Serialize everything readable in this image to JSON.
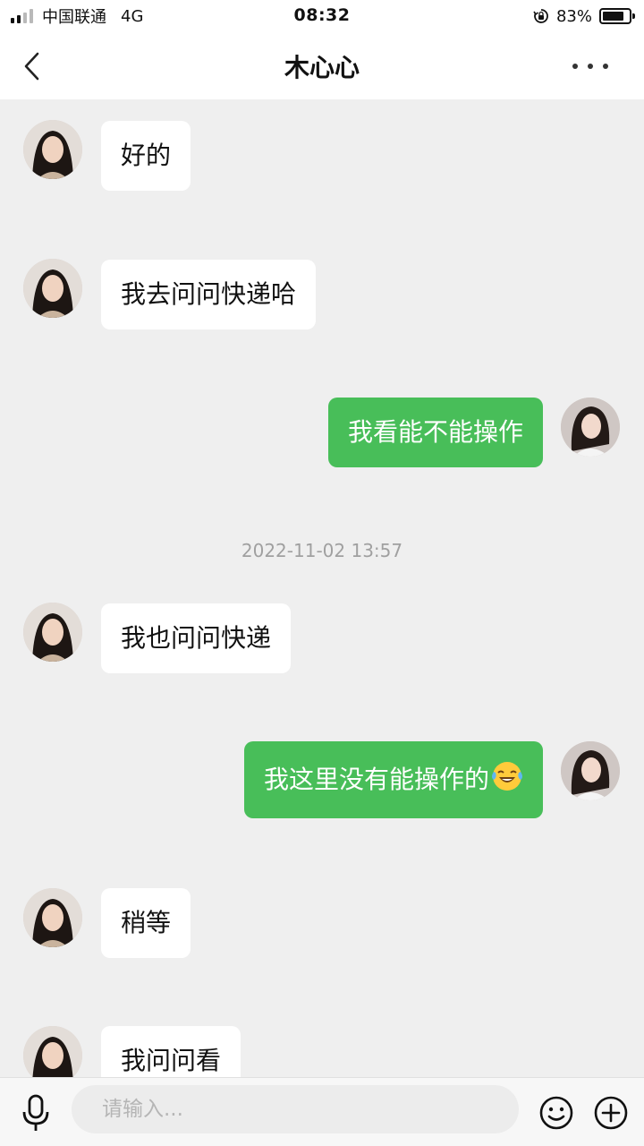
{
  "status_bar": {
    "carrier": "中国联通",
    "network": "4G",
    "time": "08:32",
    "battery_percent": "83%",
    "battery_level": 0.83
  },
  "nav": {
    "title": "木心心",
    "back_icon": "chevron-left-icon",
    "more_icon": "more-dots-icon"
  },
  "messages": [
    {
      "direction": "in",
      "text": "好的"
    },
    {
      "direction": "in",
      "text": "我去问问快递哈"
    },
    {
      "direction": "out",
      "text": "我看能不能操作"
    },
    {
      "type": "timestamp",
      "text": "2022-11-02 13:57"
    },
    {
      "direction": "in",
      "text": "我也问问快递"
    },
    {
      "direction": "out",
      "text": "我这里没有能操作的",
      "emoji": "laughing-crying-emoji"
    },
    {
      "direction": "in",
      "text": "稍等"
    },
    {
      "direction": "in",
      "text": "我问问看"
    }
  ],
  "input": {
    "placeholder": "请输入...",
    "value": ""
  },
  "colors": {
    "outgoing_bubble": "#48be59",
    "incoming_bubble": "#ffffff",
    "chat_background": "#efefef"
  }
}
